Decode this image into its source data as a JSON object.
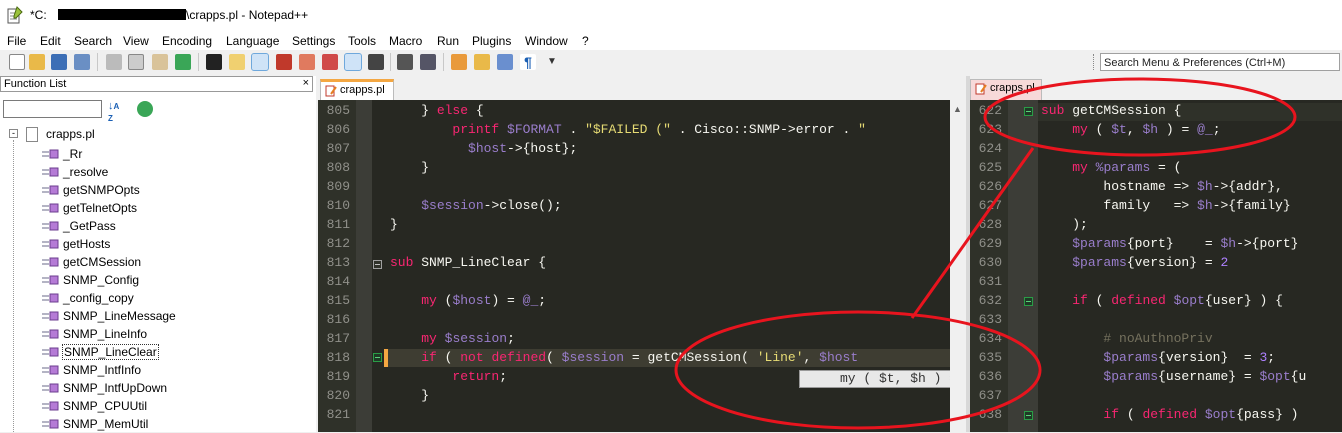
{
  "window": {
    "title_prefix": "*C:",
    "title_suffix": "\\crapps.pl - Notepad++"
  },
  "menu": [
    "File",
    "Edit",
    "Search",
    "View",
    "Encoding",
    "Language",
    "Settings",
    "Tools",
    "Macro",
    "Run",
    "Plugins",
    "Window",
    "?"
  ],
  "search": {
    "placeholder": "Search Menu & Preferences (Ctrl+M)"
  },
  "function_list": {
    "title": "Function List",
    "close": "×",
    "root": "crapps.pl",
    "items": [
      "_Rr",
      "_resolve",
      "getSNMPOpts",
      "getTelnetOpts",
      "_GetPass",
      "getHosts",
      "getCMSession",
      "SNMP_Config",
      "_config_copy",
      "SNMP_LineMessage",
      "SNMP_LineInfo",
      "SNMP_LineClear",
      "SNMP_IntfInfo",
      "SNMP_IntfUpDown",
      "SNMP_CPUUtil",
      "SNMP_MemUtil"
    ],
    "selected": "SNMP_LineClear"
  },
  "tabs": {
    "left": "crapps.pl",
    "right": "crapps.pl"
  },
  "left_editor": {
    "lines": [
      {
        "n": "805",
        "text": "    } else {"
      },
      {
        "n": "806",
        "text": "        printf $FORMAT . \"$FAILED (\" . Cisco::SNMP->error . \""
      },
      {
        "n": "807",
        "text": "          $host->{host};"
      },
      {
        "n": "808",
        "text": "    }"
      },
      {
        "n": "809",
        "text": ""
      },
      {
        "n": "810",
        "text": "    $session->close();"
      },
      {
        "n": "811",
        "text": "}"
      },
      {
        "n": "812",
        "text": ""
      },
      {
        "n": "813",
        "text": "sub SNMP_LineClear {"
      },
      {
        "n": "814",
        "text": ""
      },
      {
        "n": "815",
        "text": "    my ($host) = @_;"
      },
      {
        "n": "816",
        "text": ""
      },
      {
        "n": "817",
        "text": "    my $session;"
      },
      {
        "n": "818",
        "text": "    if ( not defined( $session = getCMSession( 'Line', $host"
      },
      {
        "n": "819",
        "text": "        return;"
      },
      {
        "n": "820",
        "text": "    }"
      },
      {
        "n": "821",
        "text": ""
      }
    ]
  },
  "calltip": "my ( $t, $h ) = @_;",
  "right_editor": {
    "lines": [
      {
        "n": "622",
        "text": "sub getCMSession {"
      },
      {
        "n": "623",
        "text": "    my ( $t, $h ) = @_;"
      },
      {
        "n": "624",
        "text": ""
      },
      {
        "n": "625",
        "text": "    my %params = ("
      },
      {
        "n": "626",
        "text": "        hostname => $h->{addr},"
      },
      {
        "n": "627",
        "text": "        family   => $h->{family}"
      },
      {
        "n": "628",
        "text": "    );"
      },
      {
        "n": "629",
        "text": "    $params{port}    = $h->{port}"
      },
      {
        "n": "630",
        "text": "    $params{version} = 2"
      },
      {
        "n": "631",
        "text": ""
      },
      {
        "n": "632",
        "text": "    if ( defined $opt{user} ) {"
      },
      {
        "n": "633",
        "text": ""
      },
      {
        "n": "634",
        "text": "        # noAuthnoPriv"
      },
      {
        "n": "635",
        "text": "        $params{version}  = 3;"
      },
      {
        "n": "636",
        "text": "        $params{username} = $opt{u"
      },
      {
        "n": "637",
        "text": ""
      },
      {
        "n": "638",
        "text": "        if ( defined $opt{pass} )"
      }
    ]
  },
  "colors": {
    "editor_bg": "#272822",
    "annotation": "#e8141e",
    "keyword": "#f92672",
    "function": "#a6e22e",
    "string": "#e6db74",
    "variable": "#9a7ecc"
  },
  "icons": [
    "notepad-app-icon",
    "new-file-icon",
    "open-file-icon",
    "save-icon",
    "save-all-icon",
    "close-icon",
    "close-all-icon",
    "print-icon",
    "cut-icon",
    "copy-icon",
    "paste-icon",
    "undo-icon",
    "redo-icon",
    "find-icon",
    "replace-icon",
    "zoom-in-icon",
    "zoom-out-icon",
    "sync-v-icon",
    "sync-h-icon",
    "wrap-icon",
    "all-chars-icon",
    "indent-guide-icon",
    "function-list-icon",
    "folder-workspace-icon",
    "doc-map-icon",
    "record-macro-icon",
    "stop-record-icon",
    "play-macro-icon",
    "run-macro-icon",
    "save-macro-icon",
    "dropdown-icon",
    "sort-icon",
    "refresh-icon",
    "function-icon",
    "file-icon"
  ]
}
